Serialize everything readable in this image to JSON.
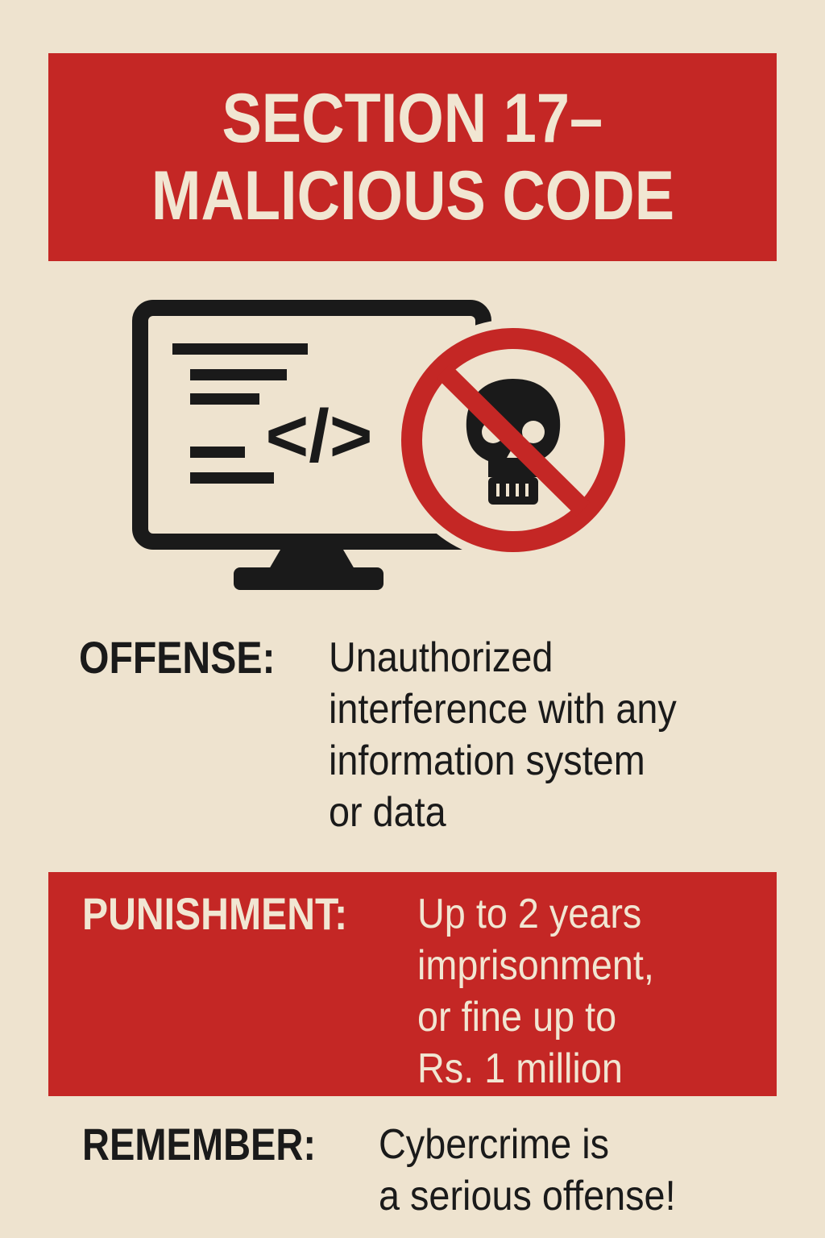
{
  "title": {
    "line1": "SECTION 17–",
    "line2": "MALICIOUS CODE"
  },
  "illustration": {
    "code_glyph": "</>",
    "icons": [
      "computer-monitor-icon",
      "code-lines-icon",
      "no-skull-prohibition-icon"
    ]
  },
  "offense": {
    "label": "OFFENSE:",
    "lines": [
      "Unauthorized",
      "interference with any",
      "information system",
      "or data"
    ]
  },
  "punishment": {
    "label": "PUNISHMENT:",
    "lines": [
      "Up to 2 years",
      "imprisonment,",
      "or fine up to",
      "Rs. 1 million"
    ]
  },
  "remember": {
    "label": "REMEMBER:",
    "lines": [
      "Cybercrime is",
      "a serious offense!"
    ]
  },
  "colors": {
    "background": "#eee3cf",
    "accent_red": "#c42725",
    "ink": "#1a1a1a",
    "banner_text": "#f1e6d2"
  }
}
